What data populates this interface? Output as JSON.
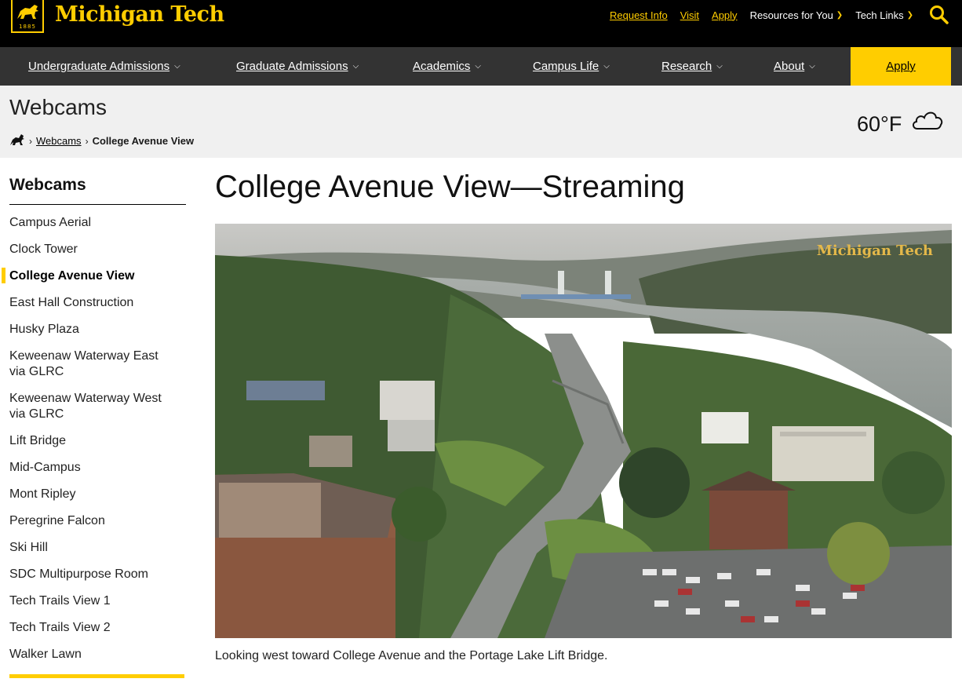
{
  "brand": {
    "name": "Michigan Tech",
    "year": "1885",
    "accent": "#ffcd00"
  },
  "utility": {
    "links": [
      "Request Info",
      "Visit",
      "Apply"
    ],
    "dropdowns": [
      "Resources for You",
      "Tech Links"
    ],
    "search_icon": "search-icon"
  },
  "nav": {
    "items": [
      {
        "label": "Undergraduate Admissions"
      },
      {
        "label": "Graduate Admissions"
      },
      {
        "label": "Academics"
      },
      {
        "label": "Campus Life"
      },
      {
        "label": "Research"
      },
      {
        "label": "About"
      }
    ],
    "apply": "Apply"
  },
  "page": {
    "title": "Webcams",
    "breadcrumb": {
      "link": "Webcams",
      "current": "College Avenue View"
    },
    "weather": {
      "temp": "60°F",
      "icon": "cloud-icon"
    }
  },
  "sidebar": {
    "heading": "Webcams",
    "items": [
      "Campus Aerial",
      "Clock Tower",
      "College Avenue View",
      "East Hall Construction",
      "Husky Plaza",
      "Keweenaw Waterway East via GLRC",
      "Keweenaw Waterway West via GLRC",
      "Lift Bridge",
      "Mid-Campus",
      "Mont Ripley",
      "Peregrine Falcon",
      "Ski Hill",
      "SDC Multipurpose Room",
      "Tech Trails View 1",
      "Tech Trails View 2",
      "Walker Lawn"
    ],
    "active_index": 2
  },
  "main": {
    "heading": "College Avenue View—Streaming",
    "watermark": "Michigan Tech",
    "caption": "Looking west toward College Avenue and the Portage Lake Lift Bridge."
  }
}
